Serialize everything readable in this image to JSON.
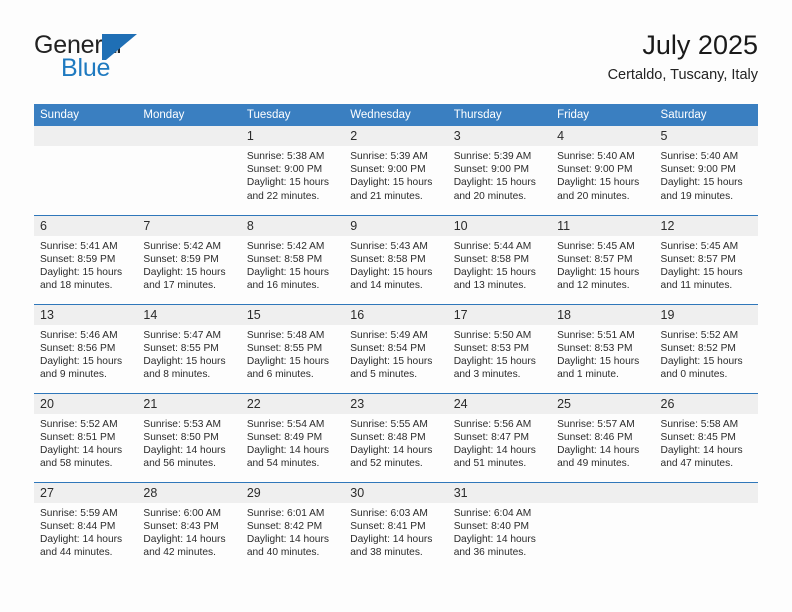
{
  "brand": {
    "name_part1": "General",
    "name_part2": "Blue",
    "flag_icon": "triangle-flag-icon",
    "accent_color": "#1f7ac0"
  },
  "header": {
    "title": "July 2025",
    "location": "Certaldo, Tuscany, Italy"
  },
  "theme": {
    "header_bg": "#3a7fc1",
    "divider": "#2f77ba",
    "daynum_bg": "#efefef",
    "page_bg": "#fdfdfd",
    "text": "#2b2b2b"
  },
  "calendar": {
    "weekday_headers": [
      "Sunday",
      "Monday",
      "Tuesday",
      "Wednesday",
      "Thursday",
      "Friday",
      "Saturday"
    ],
    "weeks": [
      [
        {
          "day": "",
          "sunrise": "",
          "sunset": "",
          "daylight_line1": "",
          "daylight_line2": "",
          "blank": true
        },
        {
          "day": "",
          "sunrise": "",
          "sunset": "",
          "daylight_line1": "",
          "daylight_line2": "",
          "blank": true
        },
        {
          "day": "1",
          "sunrise": "Sunrise: 5:38 AM",
          "sunset": "Sunset: 9:00 PM",
          "daylight_line1": "Daylight: 15 hours",
          "daylight_line2": "and 22 minutes."
        },
        {
          "day": "2",
          "sunrise": "Sunrise: 5:39 AM",
          "sunset": "Sunset: 9:00 PM",
          "daylight_line1": "Daylight: 15 hours",
          "daylight_line2": "and 21 minutes."
        },
        {
          "day": "3",
          "sunrise": "Sunrise: 5:39 AM",
          "sunset": "Sunset: 9:00 PM",
          "daylight_line1": "Daylight: 15 hours",
          "daylight_line2": "and 20 minutes."
        },
        {
          "day": "4",
          "sunrise": "Sunrise: 5:40 AM",
          "sunset": "Sunset: 9:00 PM",
          "daylight_line1": "Daylight: 15 hours",
          "daylight_line2": "and 20 minutes."
        },
        {
          "day": "5",
          "sunrise": "Sunrise: 5:40 AM",
          "sunset": "Sunset: 9:00 PM",
          "daylight_line1": "Daylight: 15 hours",
          "daylight_line2": "and 19 minutes."
        }
      ],
      [
        {
          "day": "6",
          "sunrise": "Sunrise: 5:41 AM",
          "sunset": "Sunset: 8:59 PM",
          "daylight_line1": "Daylight: 15 hours",
          "daylight_line2": "and 18 minutes."
        },
        {
          "day": "7",
          "sunrise": "Sunrise: 5:42 AM",
          "sunset": "Sunset: 8:59 PM",
          "daylight_line1": "Daylight: 15 hours",
          "daylight_line2": "and 17 minutes."
        },
        {
          "day": "8",
          "sunrise": "Sunrise: 5:42 AM",
          "sunset": "Sunset: 8:58 PM",
          "daylight_line1": "Daylight: 15 hours",
          "daylight_line2": "and 16 minutes."
        },
        {
          "day": "9",
          "sunrise": "Sunrise: 5:43 AM",
          "sunset": "Sunset: 8:58 PM",
          "daylight_line1": "Daylight: 15 hours",
          "daylight_line2": "and 14 minutes."
        },
        {
          "day": "10",
          "sunrise": "Sunrise: 5:44 AM",
          "sunset": "Sunset: 8:58 PM",
          "daylight_line1": "Daylight: 15 hours",
          "daylight_line2": "and 13 minutes."
        },
        {
          "day": "11",
          "sunrise": "Sunrise: 5:45 AM",
          "sunset": "Sunset: 8:57 PM",
          "daylight_line1": "Daylight: 15 hours",
          "daylight_line2": "and 12 minutes."
        },
        {
          "day": "12",
          "sunrise": "Sunrise: 5:45 AM",
          "sunset": "Sunset: 8:57 PM",
          "daylight_line1": "Daylight: 15 hours",
          "daylight_line2": "and 11 minutes."
        }
      ],
      [
        {
          "day": "13",
          "sunrise": "Sunrise: 5:46 AM",
          "sunset": "Sunset: 8:56 PM",
          "daylight_line1": "Daylight: 15 hours",
          "daylight_line2": "and 9 minutes."
        },
        {
          "day": "14",
          "sunrise": "Sunrise: 5:47 AM",
          "sunset": "Sunset: 8:55 PM",
          "daylight_line1": "Daylight: 15 hours",
          "daylight_line2": "and 8 minutes."
        },
        {
          "day": "15",
          "sunrise": "Sunrise: 5:48 AM",
          "sunset": "Sunset: 8:55 PM",
          "daylight_line1": "Daylight: 15 hours",
          "daylight_line2": "and 6 minutes."
        },
        {
          "day": "16",
          "sunrise": "Sunrise: 5:49 AM",
          "sunset": "Sunset: 8:54 PM",
          "daylight_line1": "Daylight: 15 hours",
          "daylight_line2": "and 5 minutes."
        },
        {
          "day": "17",
          "sunrise": "Sunrise: 5:50 AM",
          "sunset": "Sunset: 8:53 PM",
          "daylight_line1": "Daylight: 15 hours",
          "daylight_line2": "and 3 minutes."
        },
        {
          "day": "18",
          "sunrise": "Sunrise: 5:51 AM",
          "sunset": "Sunset: 8:53 PM",
          "daylight_line1": "Daylight: 15 hours",
          "daylight_line2": "and 1 minute."
        },
        {
          "day": "19",
          "sunrise": "Sunrise: 5:52 AM",
          "sunset": "Sunset: 8:52 PM",
          "daylight_line1": "Daylight: 15 hours",
          "daylight_line2": "and 0 minutes."
        }
      ],
      [
        {
          "day": "20",
          "sunrise": "Sunrise: 5:52 AM",
          "sunset": "Sunset: 8:51 PM",
          "daylight_line1": "Daylight: 14 hours",
          "daylight_line2": "and 58 minutes."
        },
        {
          "day": "21",
          "sunrise": "Sunrise: 5:53 AM",
          "sunset": "Sunset: 8:50 PM",
          "daylight_line1": "Daylight: 14 hours",
          "daylight_line2": "and 56 minutes."
        },
        {
          "day": "22",
          "sunrise": "Sunrise: 5:54 AM",
          "sunset": "Sunset: 8:49 PM",
          "daylight_line1": "Daylight: 14 hours",
          "daylight_line2": "and 54 minutes."
        },
        {
          "day": "23",
          "sunrise": "Sunrise: 5:55 AM",
          "sunset": "Sunset: 8:48 PM",
          "daylight_line1": "Daylight: 14 hours",
          "daylight_line2": "and 52 minutes."
        },
        {
          "day": "24",
          "sunrise": "Sunrise: 5:56 AM",
          "sunset": "Sunset: 8:47 PM",
          "daylight_line1": "Daylight: 14 hours",
          "daylight_line2": "and 51 minutes."
        },
        {
          "day": "25",
          "sunrise": "Sunrise: 5:57 AM",
          "sunset": "Sunset: 8:46 PM",
          "daylight_line1": "Daylight: 14 hours",
          "daylight_line2": "and 49 minutes."
        },
        {
          "day": "26",
          "sunrise": "Sunrise: 5:58 AM",
          "sunset": "Sunset: 8:45 PM",
          "daylight_line1": "Daylight: 14 hours",
          "daylight_line2": "and 47 minutes."
        }
      ],
      [
        {
          "day": "27",
          "sunrise": "Sunrise: 5:59 AM",
          "sunset": "Sunset: 8:44 PM",
          "daylight_line1": "Daylight: 14 hours",
          "daylight_line2": "and 44 minutes."
        },
        {
          "day": "28",
          "sunrise": "Sunrise: 6:00 AM",
          "sunset": "Sunset: 8:43 PM",
          "daylight_line1": "Daylight: 14 hours",
          "daylight_line2": "and 42 minutes."
        },
        {
          "day": "29",
          "sunrise": "Sunrise: 6:01 AM",
          "sunset": "Sunset: 8:42 PM",
          "daylight_line1": "Daylight: 14 hours",
          "daylight_line2": "and 40 minutes."
        },
        {
          "day": "30",
          "sunrise": "Sunrise: 6:03 AM",
          "sunset": "Sunset: 8:41 PM",
          "daylight_line1": "Daylight: 14 hours",
          "daylight_line2": "and 38 minutes."
        },
        {
          "day": "31",
          "sunrise": "Sunrise: 6:04 AM",
          "sunset": "Sunset: 8:40 PM",
          "daylight_line1": "Daylight: 14 hours",
          "daylight_line2": "and 36 minutes."
        },
        {
          "day": "",
          "sunrise": "",
          "sunset": "",
          "daylight_line1": "",
          "daylight_line2": "",
          "blank": true
        },
        {
          "day": "",
          "sunrise": "",
          "sunset": "",
          "daylight_line1": "",
          "daylight_line2": "",
          "blank": true
        }
      ]
    ]
  }
}
